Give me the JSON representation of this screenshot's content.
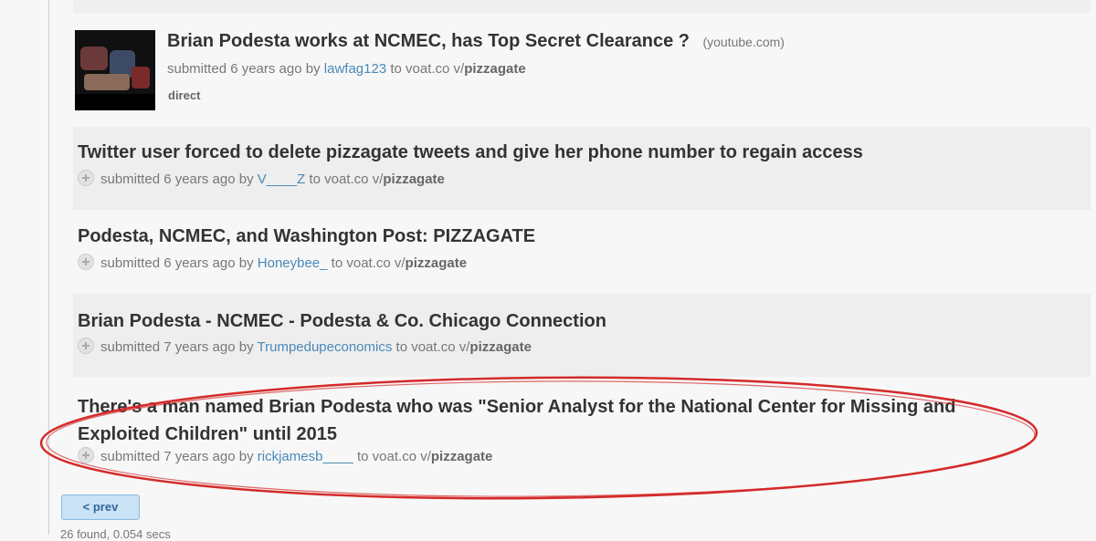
{
  "colors": {
    "link": "#4a89b8",
    "annotation": "#d42a2a",
    "button": "#c9e2f5"
  },
  "posts": [
    {
      "title": "Brian Podesta works at NCMEC, has Top Secret Clearance ?",
      "domain": "(youtube.com)",
      "submitted": "submitted 6 years ago by",
      "author": "lawfag123",
      "to": "to voat.co v/",
      "sub": "pizzagate",
      "extra": "direct",
      "thumbnail": "video-thumbnail"
    },
    {
      "title": "Twitter user forced to delete pizzagate tweets and give her phone number to regain access",
      "submitted": "submitted 6 years ago by",
      "author": "V____Z",
      "to": "to voat.co v/",
      "sub": "pizzagate"
    },
    {
      "title": "Podesta, NCMEC, and Washington Post: PIZZAGATE",
      "submitted": "submitted 6 years ago by",
      "author": "Honeybee_",
      "to": "to voat.co v/",
      "sub": "pizzagate"
    },
    {
      "title": "Brian Podesta - NCMEC - Podesta & Co. Chicago Connection",
      "submitted": "submitted 7 years ago by",
      "author": "Trumpedupeconomics",
      "to": "to voat.co v/",
      "sub": "pizzagate"
    },
    {
      "title_line1": "There's a man named Brian Podesta who was \"Senior Analyst for the National Center for Missing and",
      "title_line2": "Exploited Children\" until 2015",
      "submitted": "submitted 7 years ago by",
      "author": "rickjamesb____",
      "to": "to voat.co v/",
      "sub": "pizzagate"
    }
  ],
  "pagination": {
    "prev_label": "< prev"
  },
  "search_stats": "26 found, 0.054 secs"
}
